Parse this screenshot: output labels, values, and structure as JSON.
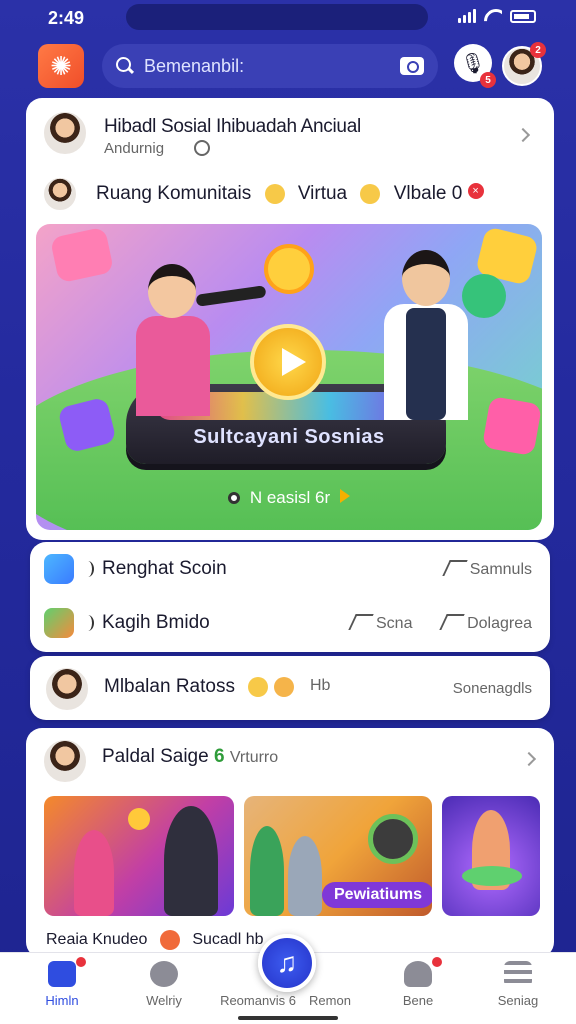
{
  "status_bar": {
    "time": "2:49"
  },
  "search": {
    "placeholder": "Bemenanbil:"
  },
  "header_badges": {
    "mic": "5",
    "profile": "2"
  },
  "post": {
    "title": "Hibadl Sosial Ihibuadah Anciual",
    "subtitle": "Andurnig",
    "community_line": "Ruang Komunitais",
    "community_mid": "Virtua",
    "community_end": "Vlbale 0",
    "banner_stage_label": "Sultcayani Sosnias",
    "banner_cta": "N easisl 6r"
  },
  "links": {
    "row1_title": "Renghat Scoin",
    "row1_action": "Samnuls",
    "row2_title": "Kagih Bmido",
    "row2_action1": "Scna",
    "row2_action2": "Dolagrea"
  },
  "message": {
    "title": "Mlbalan Ratoss",
    "hint": "Hb",
    "right": "Sonenagdls"
  },
  "feed": {
    "title": "Paldal Saige",
    "count": "6",
    "suffix": "Vrturro",
    "thumb_tag": "Pewiatiums",
    "caption": "Reaia Knudeo",
    "caption2": "Sucadl hb"
  },
  "nav": {
    "items": [
      {
        "label": "Himln",
        "icon": "home-icon"
      },
      {
        "label": "Welriy",
        "icon": "compass-icon"
      },
      {
        "label": "Reomanvis 6",
        "icon": "gallery-icon"
      },
      {
        "label": "Remon",
        "icon": "smile-icon"
      },
      {
        "label": "Bene",
        "icon": "user-icon"
      },
      {
        "label": "Seniag",
        "icon": "menu-icon"
      }
    ],
    "badge_home": "",
    "badge_profile": ""
  },
  "colors": {
    "brand_blue": "#2b31a8",
    "accent_orange": "#f04e2a",
    "active_nav": "#2f4de0"
  }
}
